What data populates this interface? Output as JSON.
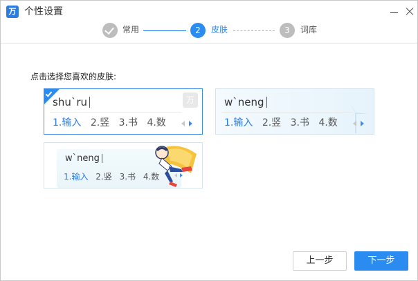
{
  "window": {
    "title": "个性设置",
    "logo_glyph": "万",
    "controls": [
      "minimize-icon",
      "close-icon"
    ]
  },
  "steps": [
    {
      "number": "1",
      "label": "常用",
      "state": "done",
      "icon": "check-icon"
    },
    {
      "number": "2",
      "label": "皮肤",
      "state": "active"
    },
    {
      "number": "3",
      "label": "词库",
      "state": "todo"
    }
  ],
  "content": {
    "prompt": "点击选择您喜欢的皮肤:",
    "skins": [
      {
        "selected": true,
        "pinyin": "shu`ru",
        "candidates": [
          "1.输入",
          "2.竖",
          "3.书",
          "4.数"
        ],
        "brand_glyph": "万"
      },
      {
        "selected": false,
        "pinyin": "w`neng",
        "candidates": [
          "1.输入",
          "2.竖",
          "3.书",
          "4.数"
        ]
      },
      {
        "selected": false,
        "pinyin": "w`neng",
        "candidates": [
          "1.输入",
          "2.竖",
          "3.书",
          "4.数"
        ]
      }
    ]
  },
  "buttons": {
    "prev": "上一步",
    "next": "下一步"
  },
  "colors": {
    "accent": "#2a8cf0",
    "inactive_step": "#bdbdbd",
    "candidate_highlight": "#2a7de1"
  }
}
